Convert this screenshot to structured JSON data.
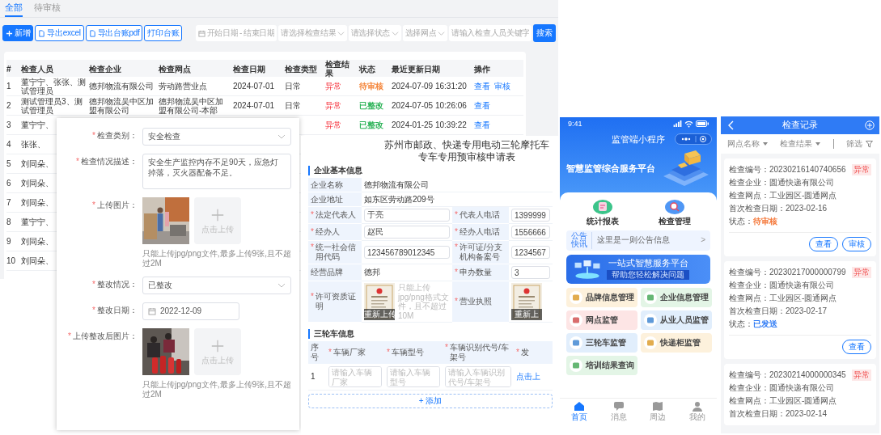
{
  "admin_list": {
    "tabs": [
      {
        "label": "全部",
        "selected": true
      },
      {
        "label": "待审核",
        "selected": false
      }
    ],
    "buttons": [
      {
        "label": "新增",
        "kind": "primary"
      },
      {
        "label": "导出excel",
        "kind": "export"
      },
      {
        "label": "导出台账pdf",
        "kind": "export"
      },
      {
        "label": "打印台账",
        "kind": "plain"
      }
    ],
    "filters": [
      {
        "kind": "daterange",
        "placeholder": "开始日期",
        "separator": "-",
        "end_placeholder": "结束日期"
      },
      {
        "kind": "select",
        "placeholder": "请选择检查结果"
      },
      {
        "kind": "select",
        "placeholder": "请选择状态"
      },
      {
        "kind": "select",
        "placeholder": "选择网点"
      },
      {
        "kind": "text",
        "placeholder": "请输入检查人员关键字"
      }
    ],
    "search_button": "搜索",
    "table": {
      "columns": [
        "#",
        "检查人员",
        "检查企业",
        "检查网点",
        "检查日期",
        "检查类型",
        "检查结果",
        "状态",
        "最近更新日期",
        "操作"
      ],
      "rows": [
        {
          "no": "1",
          "inspector": "董宁宁、张张、测试管理员",
          "company": "德邦物流有限公司",
          "site": "劳动路营业点",
          "date": "2024-07-01",
          "type": "日常",
          "result": "异常",
          "status": {
            "text": "待审核",
            "color": "#f5863b"
          },
          "updated": "2024-07-09 16:31:20",
          "actions": [
            "查看",
            "审核"
          ]
        },
        {
          "no": "2",
          "inspector": "测试管理员3、测试管理员",
          "company": "德邦物流吴中区加盟有限公司",
          "site": "德邦物流吴中区加盟有限公司-本部",
          "date": "2024-07-01",
          "type": "日常",
          "result": "异常",
          "status": {
            "text": "已整改",
            "color": "#2fb45a"
          },
          "updated": "2024-07-05 10:26:06",
          "actions": [
            "查看"
          ]
        },
        {
          "no": "3",
          "inspector": "董宁宁、",
          "result": "异常",
          "status": {
            "text": "已整改",
            "color": "#2fb45a"
          },
          "updated": "2024-01-25 10:39:22",
          "actions": [
            "查看"
          ]
        },
        {
          "no": "4",
          "inspector": "张张、"
        },
        {
          "no": "5",
          "inspector": "刘同朵、"
        },
        {
          "no": "6",
          "inspector": "刘同朵、"
        },
        {
          "no": "7",
          "inspector": "刘同朵、"
        },
        {
          "no": "8",
          "inspector": "董宁宁、"
        },
        {
          "no": "9",
          "inspector": "刘同朵、"
        },
        {
          "no": "10",
          "inspector": "刘同朵、"
        }
      ]
    }
  },
  "inspection_form": {
    "fields": [
      {
        "kind": "select",
        "mark": "*",
        "label": "检查类别：",
        "value": "安全检查"
      },
      {
        "kind": "textarea",
        "mark": "*",
        "label": "检查情况描述：",
        "value": "安全生产监控内存不足90天，应急灯掉落，灭火器配备不足。"
      },
      {
        "kind": "upload",
        "mark": "*",
        "label": "上传图片：",
        "upload_label": "点击上传",
        "hint": "只能上传jpg/png文件,最多上传9张,且不超过2M"
      },
      {
        "kind": "select",
        "mark": "*",
        "label": "整改情况：",
        "value": "已整改"
      },
      {
        "kind": "date",
        "mark": "*",
        "label": "整改日期：",
        "value": "2022-12-09"
      },
      {
        "kind": "upload",
        "mark": "*",
        "label": "上传整改后图片：",
        "upload_label": "点击上传",
        "hint": "只能上传jpg/png文件,最多上传9张,且不超过2M"
      }
    ]
  },
  "application_form": {
    "title_lines": [
      "苏州市邮政、快递专用电动三轮摩托车",
      "专车专用预审核申请表"
    ],
    "company_section": {
      "heading": "企业基本信息",
      "rows": [
        {
          "cells": [
            {
              "label": "企业名称",
              "kind": "text",
              "value": "德邦物流有限公司"
            }
          ]
        },
        {
          "cells": [
            {
              "label": "企业地址",
              "kind": "text",
              "value": "如东区劳动路209号"
            }
          ]
        },
        {
          "cells": [
            {
              "label": "法定代表人",
              "mark": "*",
              "kind": "input",
              "value": "于亮"
            },
            {
              "label": "代表人电话",
              "mark": "*",
              "kind": "input",
              "value": "1399999"
            }
          ]
        },
        {
          "cells": [
            {
              "label": "经办人",
              "mark": "*",
              "kind": "input",
              "value": "赵民"
            },
            {
              "label": "经办人电话",
              "mark": "*",
              "kind": "input",
              "value": "1556666"
            }
          ]
        },
        {
          "cells": [
            {
              "label": "统一社会信用代码",
              "mark": "*",
              "kind": "input",
              "value": "123456789012345"
            },
            {
              "label": "许可证/分支机构备案号",
              "mark": "*",
              "kind": "input",
              "value": "1234567"
            }
          ]
        },
        {
          "cells": [
            {
              "label": "经营品牌",
              "kind": "text",
              "value": "德邦"
            },
            {
              "label": "申办数量",
              "mark": "*",
              "kind": "input",
              "value": "3"
            }
          ]
        },
        {
          "cells": [
            {
              "label": "许可资质证明",
              "mark": "*",
              "kind": "upload",
              "button": "重新上传",
              "hint": "只能上传jpg/png格式文件，且不超过10M"
            },
            {
              "label": "营业执照",
              "mark": "*",
              "kind": "upload",
              "button": "重新上"
            }
          ]
        }
      ]
    },
    "vehicle_section": {
      "heading": "三轮车信息",
      "columns": [
        {
          "label": "序号"
        },
        {
          "label": "车辆厂家",
          "mark": "*"
        },
        {
          "label": "车辆型号",
          "mark": "*"
        },
        {
          "label": "车辆识别代号/车架号",
          "mark": "*"
        },
        {
          "label": "发",
          "mark": "*"
        }
      ],
      "rows": [
        {
          "no": "1",
          "placeholders": [
            "请输入车辆厂家",
            "请输入车辆型号",
            "请输入车辆识别代号/车架号"
          ],
          "link": "点击上"
        }
      ],
      "add_button": "+ 添加"
    }
  },
  "phone": {
    "status_time": "9:41",
    "title": "监管端小程序",
    "banner_title": "智慧监管综合服务平台",
    "shortcuts": [
      "统计报表",
      "检查管理"
    ],
    "notice": {
      "tag": [
        "公告",
        "快讯"
      ],
      "text": "这里是一则公告信息",
      "arrow": ">"
    },
    "promo": {
      "title": "一站式智慧服务平台",
      "subtitle": "帮助您轻松解决问题"
    },
    "tiles": [
      {
        "label": "品牌信息管理",
        "color": "#fdf1dc"
      },
      {
        "label": "企业信息管理",
        "color": "#e3f5e6"
      },
      {
        "label": "网点监管",
        "color": "#fde5e5"
      },
      {
        "label": "从业人员监管",
        "color": "#e1eefc"
      },
      {
        "label": "三轮车监管",
        "color": "#e1eefc"
      },
      {
        "label": "快递柜监管",
        "color": "#fdf1dc"
      },
      {
        "label": "培训结果查询",
        "color": "#e3f5e6"
      }
    ],
    "tabbar": [
      {
        "label": "首页",
        "selected": true
      },
      {
        "label": "消息",
        "selected": false
      },
      {
        "label": "周边",
        "selected": false
      },
      {
        "label": "我的",
        "selected": false
      }
    ]
  },
  "records": {
    "title": "检查记录",
    "filters": [
      {
        "kind": "dropdown",
        "label": "网点名称"
      },
      {
        "kind": "dropdown",
        "label": "检查结果"
      },
      {
        "kind": "filter",
        "label": "筛选"
      }
    ],
    "cards": [
      {
        "tag": "异常",
        "fields": [
          {
            "label": "检查编号：",
            "value": "20230216140740656"
          },
          {
            "label": "检查企业：",
            "value": "圆通快递有限公司"
          },
          {
            "label": "检查网点：",
            "value": "工业园区-圆通网点"
          },
          {
            "label": "首次检查日期：",
            "value": "2023-02-16"
          }
        ],
        "status": {
          "label": "状态：",
          "value": "待审核",
          "color": "#f5793b"
        },
        "actions": [
          "查看",
          "审核"
        ]
      },
      {
        "tag": "异常",
        "fields": [
          {
            "label": "检查编号：",
            "value": "20230217000000799"
          },
          {
            "label": "检查企业：",
            "value": "圆通快递有限公司"
          },
          {
            "label": "检查网点：",
            "value": "工业园区-圆通网点"
          },
          {
            "label": "首次检查日期：",
            "value": "2023-02-17"
          }
        ],
        "status": {
          "label": "状态：",
          "value": "已发送",
          "color": "#2f7bf5"
        },
        "actions": [
          "查看"
        ]
      },
      {
        "tag": "异常",
        "fields": [
          {
            "label": "检查编号：",
            "value": "20230214000000345"
          },
          {
            "label": "检查企业：",
            "value": "圆通快递有限公司"
          },
          {
            "label": "检查网点：",
            "value": "工业园区-圆通网点"
          },
          {
            "label": "首次检查日期：",
            "value": "2023-02-14"
          }
        ]
      }
    ]
  }
}
